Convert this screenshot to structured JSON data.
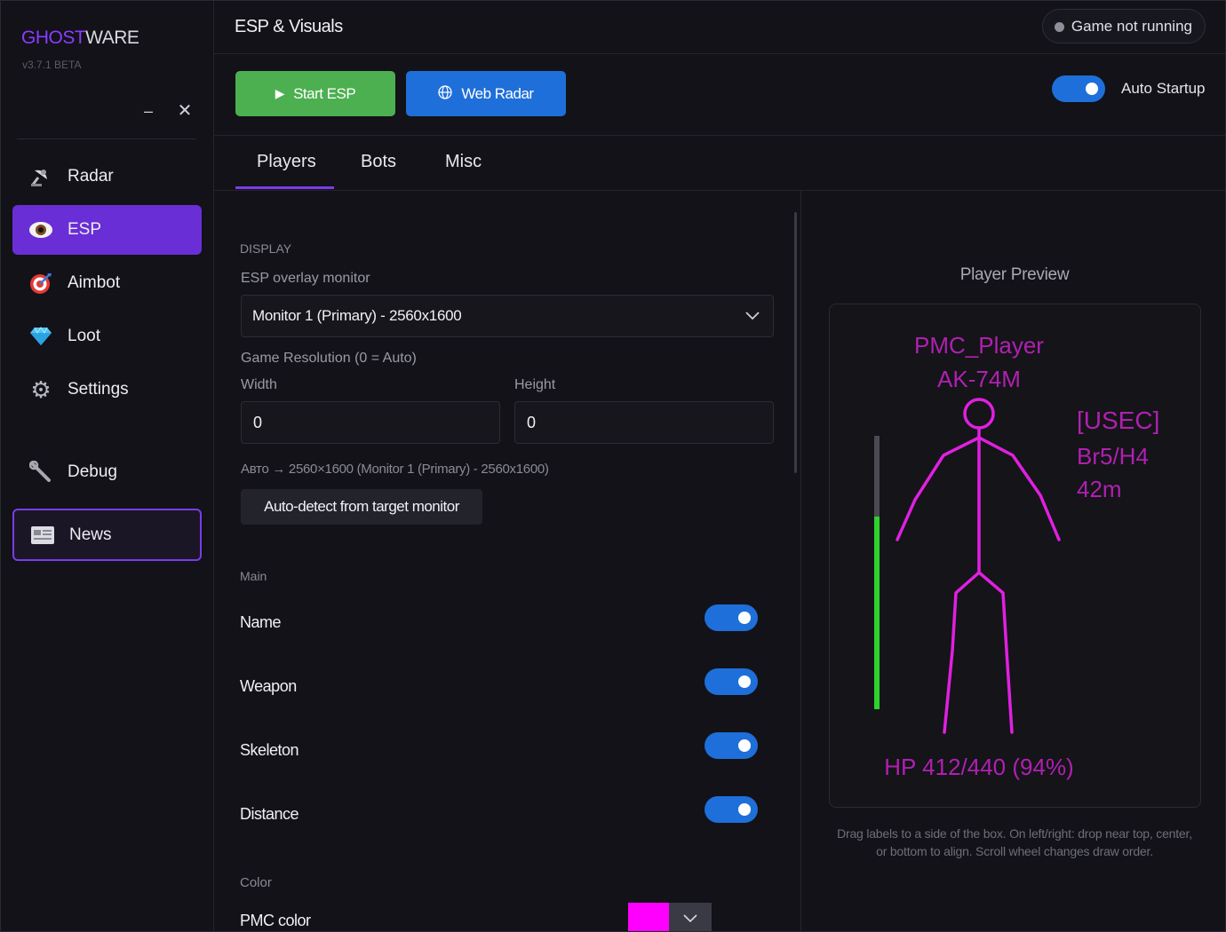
{
  "app": {
    "brand_part1": "GHOST",
    "brand_part2": "WARE",
    "version": "v3.7.1 BETA",
    "minimize_glyph": "–",
    "close_glyph": "✕"
  },
  "sidebar": {
    "items": [
      {
        "label": "Radar",
        "icon": "satellite-dish-icon"
      },
      {
        "label": "ESP",
        "icon": "eye-icon"
      },
      {
        "label": "Aimbot",
        "icon": "target-icon"
      },
      {
        "label": "Loot",
        "icon": "gem-icon"
      },
      {
        "label": "Settings",
        "icon": "gear-icon"
      },
      {
        "label": "Debug",
        "icon": "wrench-icon"
      },
      {
        "label": "News",
        "icon": "newspaper-icon"
      }
    ]
  },
  "header": {
    "title": "ESP & Visuals",
    "status": "Game not running"
  },
  "actions": {
    "start_label": "Start ESP",
    "radar_label": "Web Radar",
    "auto_startup_label": "Auto Startup",
    "auto_startup_on": true
  },
  "tabs": [
    {
      "label": "Players",
      "active": true
    },
    {
      "label": "Bots",
      "active": false
    },
    {
      "label": "Misc",
      "active": false
    }
  ],
  "display": {
    "section": "DISPLAY",
    "monitor_label": "ESP overlay monitor",
    "monitor_value": "Monitor 1 (Primary) - 2560x1600",
    "resolution_label": "Game Resolution (0 = Auto)",
    "width_label": "Width",
    "width_value": "0",
    "height_label": "Height",
    "height_value": "0",
    "hint": "Авто → 2560×1600 (Monitor 1 (Primary) - 2560x1600)",
    "autodetect_label": "Auto-detect from target monitor"
  },
  "main": {
    "section": "Main",
    "rows": [
      {
        "label": "Name",
        "on": true
      },
      {
        "label": "Weapon",
        "on": true
      },
      {
        "label": "Skeleton",
        "on": true
      },
      {
        "label": "Distance",
        "on": true
      }
    ]
  },
  "color": {
    "section": "Color",
    "pmc_label": "PMC color",
    "pmc_value": "#ff00ff",
    "dropdown_glyph": "﹀"
  },
  "preview": {
    "title": "Player Preview",
    "name": "PMC_Player",
    "weapon": "AK-74M",
    "faction": "[USEC]",
    "armor": "Br5/H4",
    "distance": "42m",
    "hp_text": "HP 412/440 (94%)",
    "hp_fraction": 0.94,
    "esp_color": "#e020e0",
    "label_color": "#b020b0",
    "hp_bar_color": "#2ed12e",
    "note": "Drag labels to a side of the box. On left/right: drop near top, center, or bottom to align. Scroll wheel changes draw order."
  },
  "colors": {
    "accent": "#7a3ce8",
    "start_green": "#4caf50",
    "radar_blue": "#1e6fd9"
  }
}
